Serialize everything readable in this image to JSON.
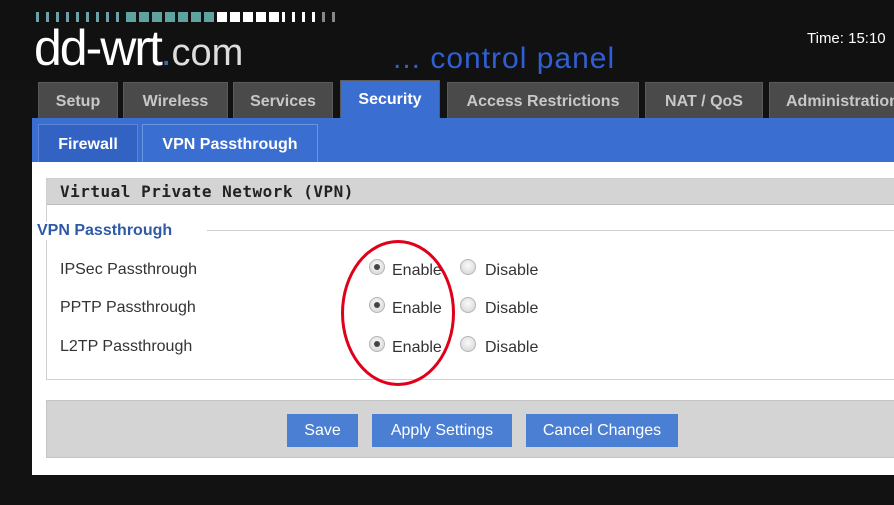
{
  "header": {
    "logo_main": "dd-wrt",
    "logo_dot": ".",
    "logo_tail": "com",
    "panel_title": "... control panel",
    "time_text": "Time: 15:10"
  },
  "nav": {
    "tabs": [
      {
        "label": "Setup",
        "active": false
      },
      {
        "label": "Wireless",
        "active": false
      },
      {
        "label": "Services",
        "active": false
      },
      {
        "label": "Security",
        "active": true
      },
      {
        "label": "Access Restrictions",
        "active": false
      },
      {
        "label": "NAT / QoS",
        "active": false
      },
      {
        "label": "Administration",
        "active": false
      }
    ],
    "subtabs": [
      {
        "label": "Firewall",
        "active": true
      },
      {
        "label": "VPN Passthrough",
        "active": false
      }
    ]
  },
  "section": {
    "title": "Virtual Private Network (VPN)",
    "legend": "VPN Passthrough",
    "rows": [
      {
        "label": "IPSec Passthrough",
        "enable": "Enable",
        "disable": "Disable",
        "value": "enable"
      },
      {
        "label": "PPTP Passthrough",
        "enable": "Enable",
        "disable": "Disable",
        "value": "enable"
      },
      {
        "label": "L2TP Passthrough",
        "enable": "Enable",
        "disable": "Disable",
        "value": "enable"
      }
    ]
  },
  "actions": {
    "save": "Save",
    "apply": "Apply Settings",
    "cancel": "Cancel Changes"
  },
  "colors": {
    "accent_blue": "#3b6ed1",
    "button_blue": "#4a7fd4",
    "highlight_red": "#e0001a",
    "header_bg": "#111111"
  }
}
